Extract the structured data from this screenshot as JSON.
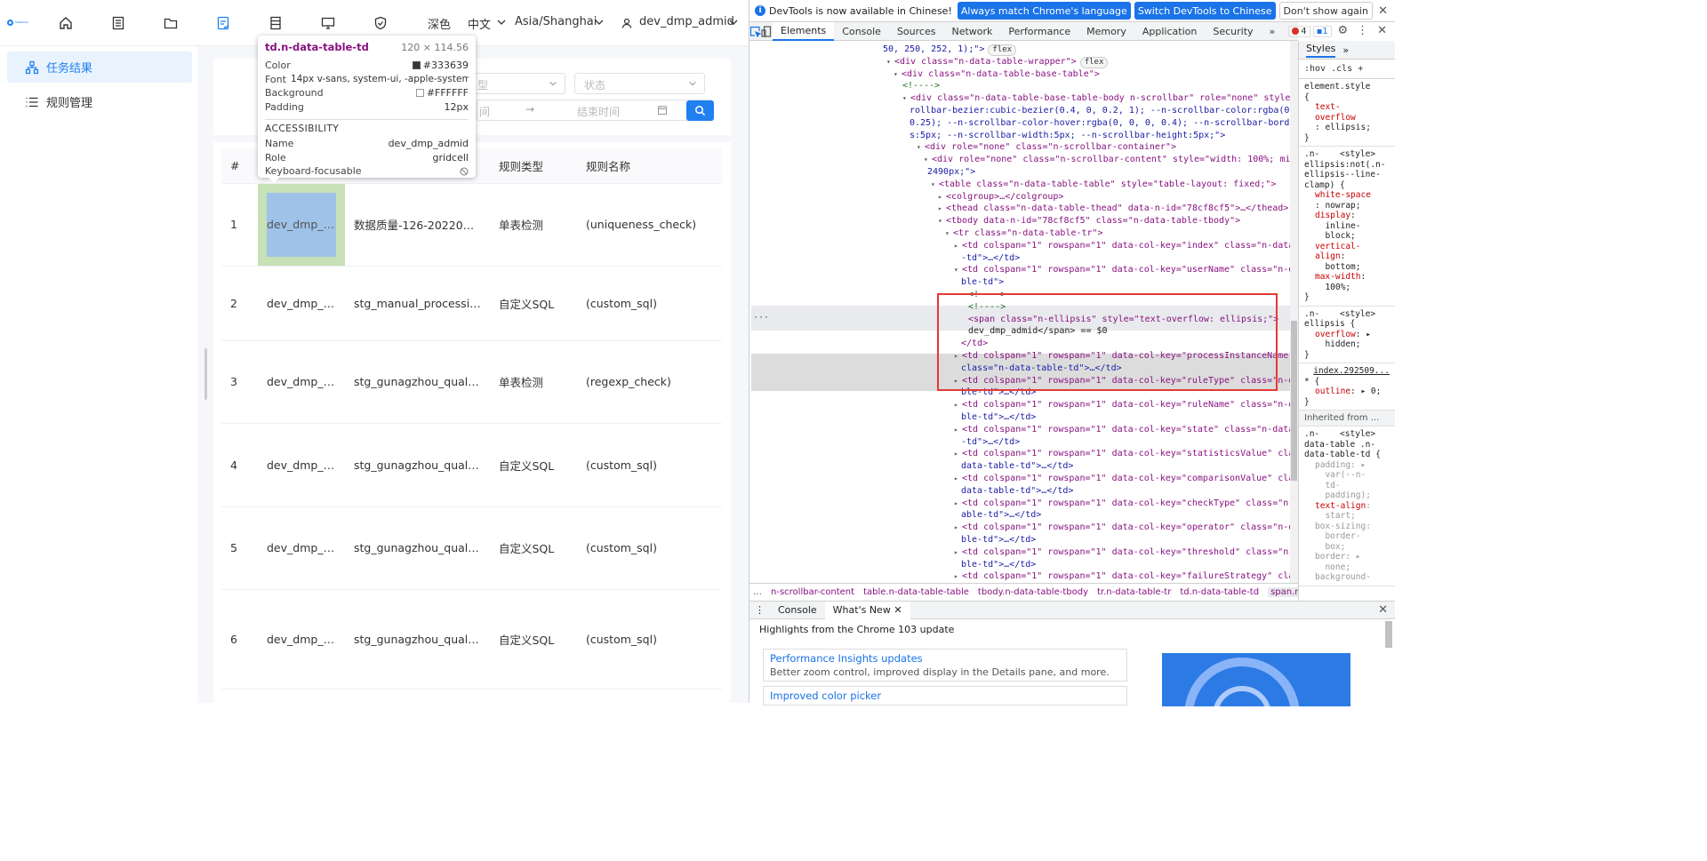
{
  "app": {
    "logo_text": "DataWorks",
    "topbar": {
      "theme_label": "深色",
      "lang_label": "中文",
      "timezone_label": "Asia/Shanghai",
      "user_label": "dev_dmp_admid"
    },
    "sidebar": {
      "items": [
        {
          "label": "任务结果",
          "icon": "sitemap-icon",
          "active": true
        },
        {
          "label": "规则管理",
          "icon": "list-icon",
          "active": false
        }
      ]
    },
    "filters": {
      "rule_type_placeholder": "型",
      "state_placeholder": "状态",
      "start_time_placeholder": "间",
      "end_time_placeholder": "结束时间"
    },
    "table": {
      "columns": [
        "#",
        "",
        "",
        "规则类型",
        "规则名称"
      ],
      "rows": [
        {
          "index": "1",
          "user": "dev_dmp_ad...",
          "process": "数据质量-126-20220727...",
          "rule_type": "单表检测",
          "rule_name": "(uniqueness_check)"
        },
        {
          "index": "2",
          "user": "dev_dmp_ad...",
          "process": "stg_manual_processing_...",
          "rule_type": "自定义SQL",
          "rule_name": "(custom_sql)"
        },
        {
          "index": "3",
          "user": "dev_dmp_ad...",
          "process": "stg_gunagzhou_quality_...",
          "rule_type": "单表检测",
          "rule_name": "(regexp_check)"
        },
        {
          "index": "4",
          "user": "dev_dmp_ad...",
          "process": "stg_gunagzhou_quality_...",
          "rule_type": "自定义SQL",
          "rule_name": "(custom_sql)"
        },
        {
          "index": "5",
          "user": "dev_dmp_ad...",
          "process": "stg_gunagzhou_quality_...",
          "rule_type": "自定义SQL",
          "rule_name": "(custom_sql)"
        },
        {
          "index": "6",
          "user": "dev_dmp_ad...",
          "process": "stg_gunagzhou_quality_...",
          "rule_type": "自定义SQL",
          "rule_name": "(custom_sql)"
        }
      ]
    },
    "tooltip": {
      "title": "td.n-data-table-td",
      "size": "120 × 114.56",
      "rows": [
        {
          "k": "Color",
          "v": "#333639"
        },
        {
          "k": "Font",
          "v": "14px v-sans, system-ui, -apple-system, Bl..."
        },
        {
          "k": "Background",
          "v": "#FFFFFF"
        },
        {
          "k": "Padding",
          "v": "12px"
        }
      ],
      "section": "ACCESSIBILITY",
      "a11y": [
        {
          "k": "Name",
          "v": "dev_dmp_admid"
        },
        {
          "k": "Role",
          "v": "gridcell"
        },
        {
          "k": "Keyboard-focusable",
          "v": ""
        }
      ]
    }
  },
  "devtools": {
    "infobar": {
      "message": "DevTools is now available in Chinese!",
      "btn_match": "Always match Chrome's language",
      "btn_switch": "Switch DevTools to Chinese",
      "btn_dismiss": "Don't show again"
    },
    "tabs": [
      "Elements",
      "Console",
      "Sources",
      "Network",
      "Performance",
      "Memory",
      "Application",
      "Security"
    ],
    "error_count": "4",
    "message_count": "1",
    "dom_lines": [
      {
        "t": "50, 250, 252, 1);\">",
        "badge": "flex"
      },
      {
        "t": "<div class=\"n-data-table-wrapper\">",
        "badge": "flex"
      },
      {
        "t": "<div class=\"n-data-table-base-table\">",
        "badge": ""
      },
      {
        "t": "<!---->",
        "badge": ""
      },
      {
        "t": "<div class=\"n-data-table-base-table-body n-scrollbar\" role=\"none\" style=\"--n-sc",
        "badge": ""
      },
      {
        "t": "rollbar-bezier:cubic-bezier(0.4, 0, 0.2, 1); --n-scrollbar-color:rgba(0, 0, 0,",
        "badge": ""
      },
      {
        "t": "0.25); --n-scrollbar-color-hover:rgba(0, 0, 0, 0.4); --n-scrollbar-border-radiu",
        "badge": ""
      },
      {
        "t": "s:5px; --n-scrollbar-width:5px; --n-scrollbar-height:5px;\">",
        "badge": ""
      },
      {
        "t": "<div role=\"none\" class=\"n-scrollbar-container\">",
        "badge": ""
      },
      {
        "t": "<div role=\"none\" class=\"n-scrollbar-content\" style=\"width: 100%; min-width:",
        "badge": ""
      },
      {
        "t": "2490px;\">",
        "badge": ""
      },
      {
        "t": "<table class=\"n-data-table-table\" style=\"table-layout: fixed;\">",
        "badge": ""
      },
      {
        "t": "<colgroup>…</colgroup>",
        "badge": ""
      },
      {
        "t": "<thead class=\"n-data-table-thead\" data-n-id=\"78cf8cf5\">…</thead>",
        "badge": ""
      },
      {
        "t": "<tbody data-n-id=\"78cf8cf5\" class=\"n-data-table-tbody\">",
        "badge": ""
      },
      {
        "t": "<tr class=\"n-data-table-tr\">",
        "badge": ""
      },
      {
        "t": "<td colspan=\"1\" rowspan=\"1\" data-col-key=\"index\" class=\"n-data-table",
        "badge": ""
      },
      {
        "t": "-td\">…</td>",
        "badge": ""
      },
      {
        "t": "<td colspan=\"1\" rowspan=\"1\" data-col-key=\"userName\" class=\"n-data-ta",
        "badge": ""
      },
      {
        "t": "ble-td\">",
        "badge": ""
      },
      {
        "t": "<!---->",
        "badge": ""
      },
      {
        "t": "<!---->",
        "badge": ""
      },
      {
        "t": "<span class=\"n-ellipsis\" style=\"text-overflow: ellipsis;\">",
        "badge": ""
      },
      {
        "t": "dev_dmp_admid</span> == $0",
        "badge": ""
      },
      {
        "t": "</td>",
        "badge": ""
      },
      {
        "t": "<td colspan=\"1\" rowspan=\"1\" data-col-key=\"processInstanceName\"",
        "badge": ""
      },
      {
        "t": "class=\"n-data-table-td\">…</td>",
        "badge": ""
      },
      {
        "t": "<td colspan=\"1\" rowspan=\"1\" data-col-key=\"ruleType\" class=\"n-data-ta",
        "badge": ""
      },
      {
        "t": "ble-td\">…</td>",
        "badge": ""
      },
      {
        "t": "<td colspan=\"1\" rowspan=\"1\" data-col-key=\"ruleName\" class=\"n-data-ta",
        "badge": ""
      },
      {
        "t": "ble-td\">…</td>",
        "badge": ""
      },
      {
        "t": "<td colspan=\"1\" rowspan=\"1\" data-col-key=\"state\" class=\"n-data-table",
        "badge": ""
      },
      {
        "t": "-td\">…</td>",
        "badge": ""
      },
      {
        "t": "<td colspan=\"1\" rowspan=\"1\" data-col-key=\"statisticsValue\" class=\"n-",
        "badge": ""
      },
      {
        "t": "data-table-td\">…</td>",
        "badge": ""
      },
      {
        "t": "<td colspan=\"1\" rowspan=\"1\" data-col-key=\"comparisonValue\" class=\"n-",
        "badge": ""
      },
      {
        "t": "data-table-td\">…</td>",
        "badge": ""
      },
      {
        "t": "<td colspan=\"1\" rowspan=\"1\" data-col-key=\"checkType\" class=\"n-data-t",
        "badge": ""
      },
      {
        "t": "able-td\">…</td>",
        "badge": ""
      },
      {
        "t": "<td colspan=\"1\" rowspan=\"1\" data-col-key=\"operator\" class=\"n-data-ta",
        "badge": ""
      },
      {
        "t": "ble-td\">…</td>",
        "badge": ""
      },
      {
        "t": "<td colspan=\"1\" rowspan=\"1\" data-col-key=\"threshold\" class=\"n-data-ta",
        "badge": ""
      },
      {
        "t": "ble-td\">…</td>",
        "badge": ""
      },
      {
        "t": "<td colspan=\"1\" rowspan=\"1\" data-col-key=\"failureStrategy\" class=\"n-",
        "badge": ""
      }
    ],
    "breadcrumbs": [
      "n-scrollbar-content",
      "table.n-data-table-table",
      "tbody.n-data-table-tbody",
      "tr.n-data-table-tr",
      "td.n-data-table-td",
      "span.n-ellipsis"
    ],
    "styles": {
      "tab_styles": "Styles",
      "filter": ":hov .cls",
      "element_style": "element.style",
      "inherited": "Inherited from ...",
      "source_link": "index.292509..."
    },
    "drawer": {
      "tab_console": "Console",
      "tab_whatsnew": "What's New",
      "heading": "Highlights from the Chrome 103 update",
      "cards": [
        {
          "h": "Performance Insights updates",
          "d": "Better zoom control, improved display in the Details pane, and more."
        },
        {
          "h": "Improved color picker",
          "d": ""
        }
      ]
    }
  }
}
